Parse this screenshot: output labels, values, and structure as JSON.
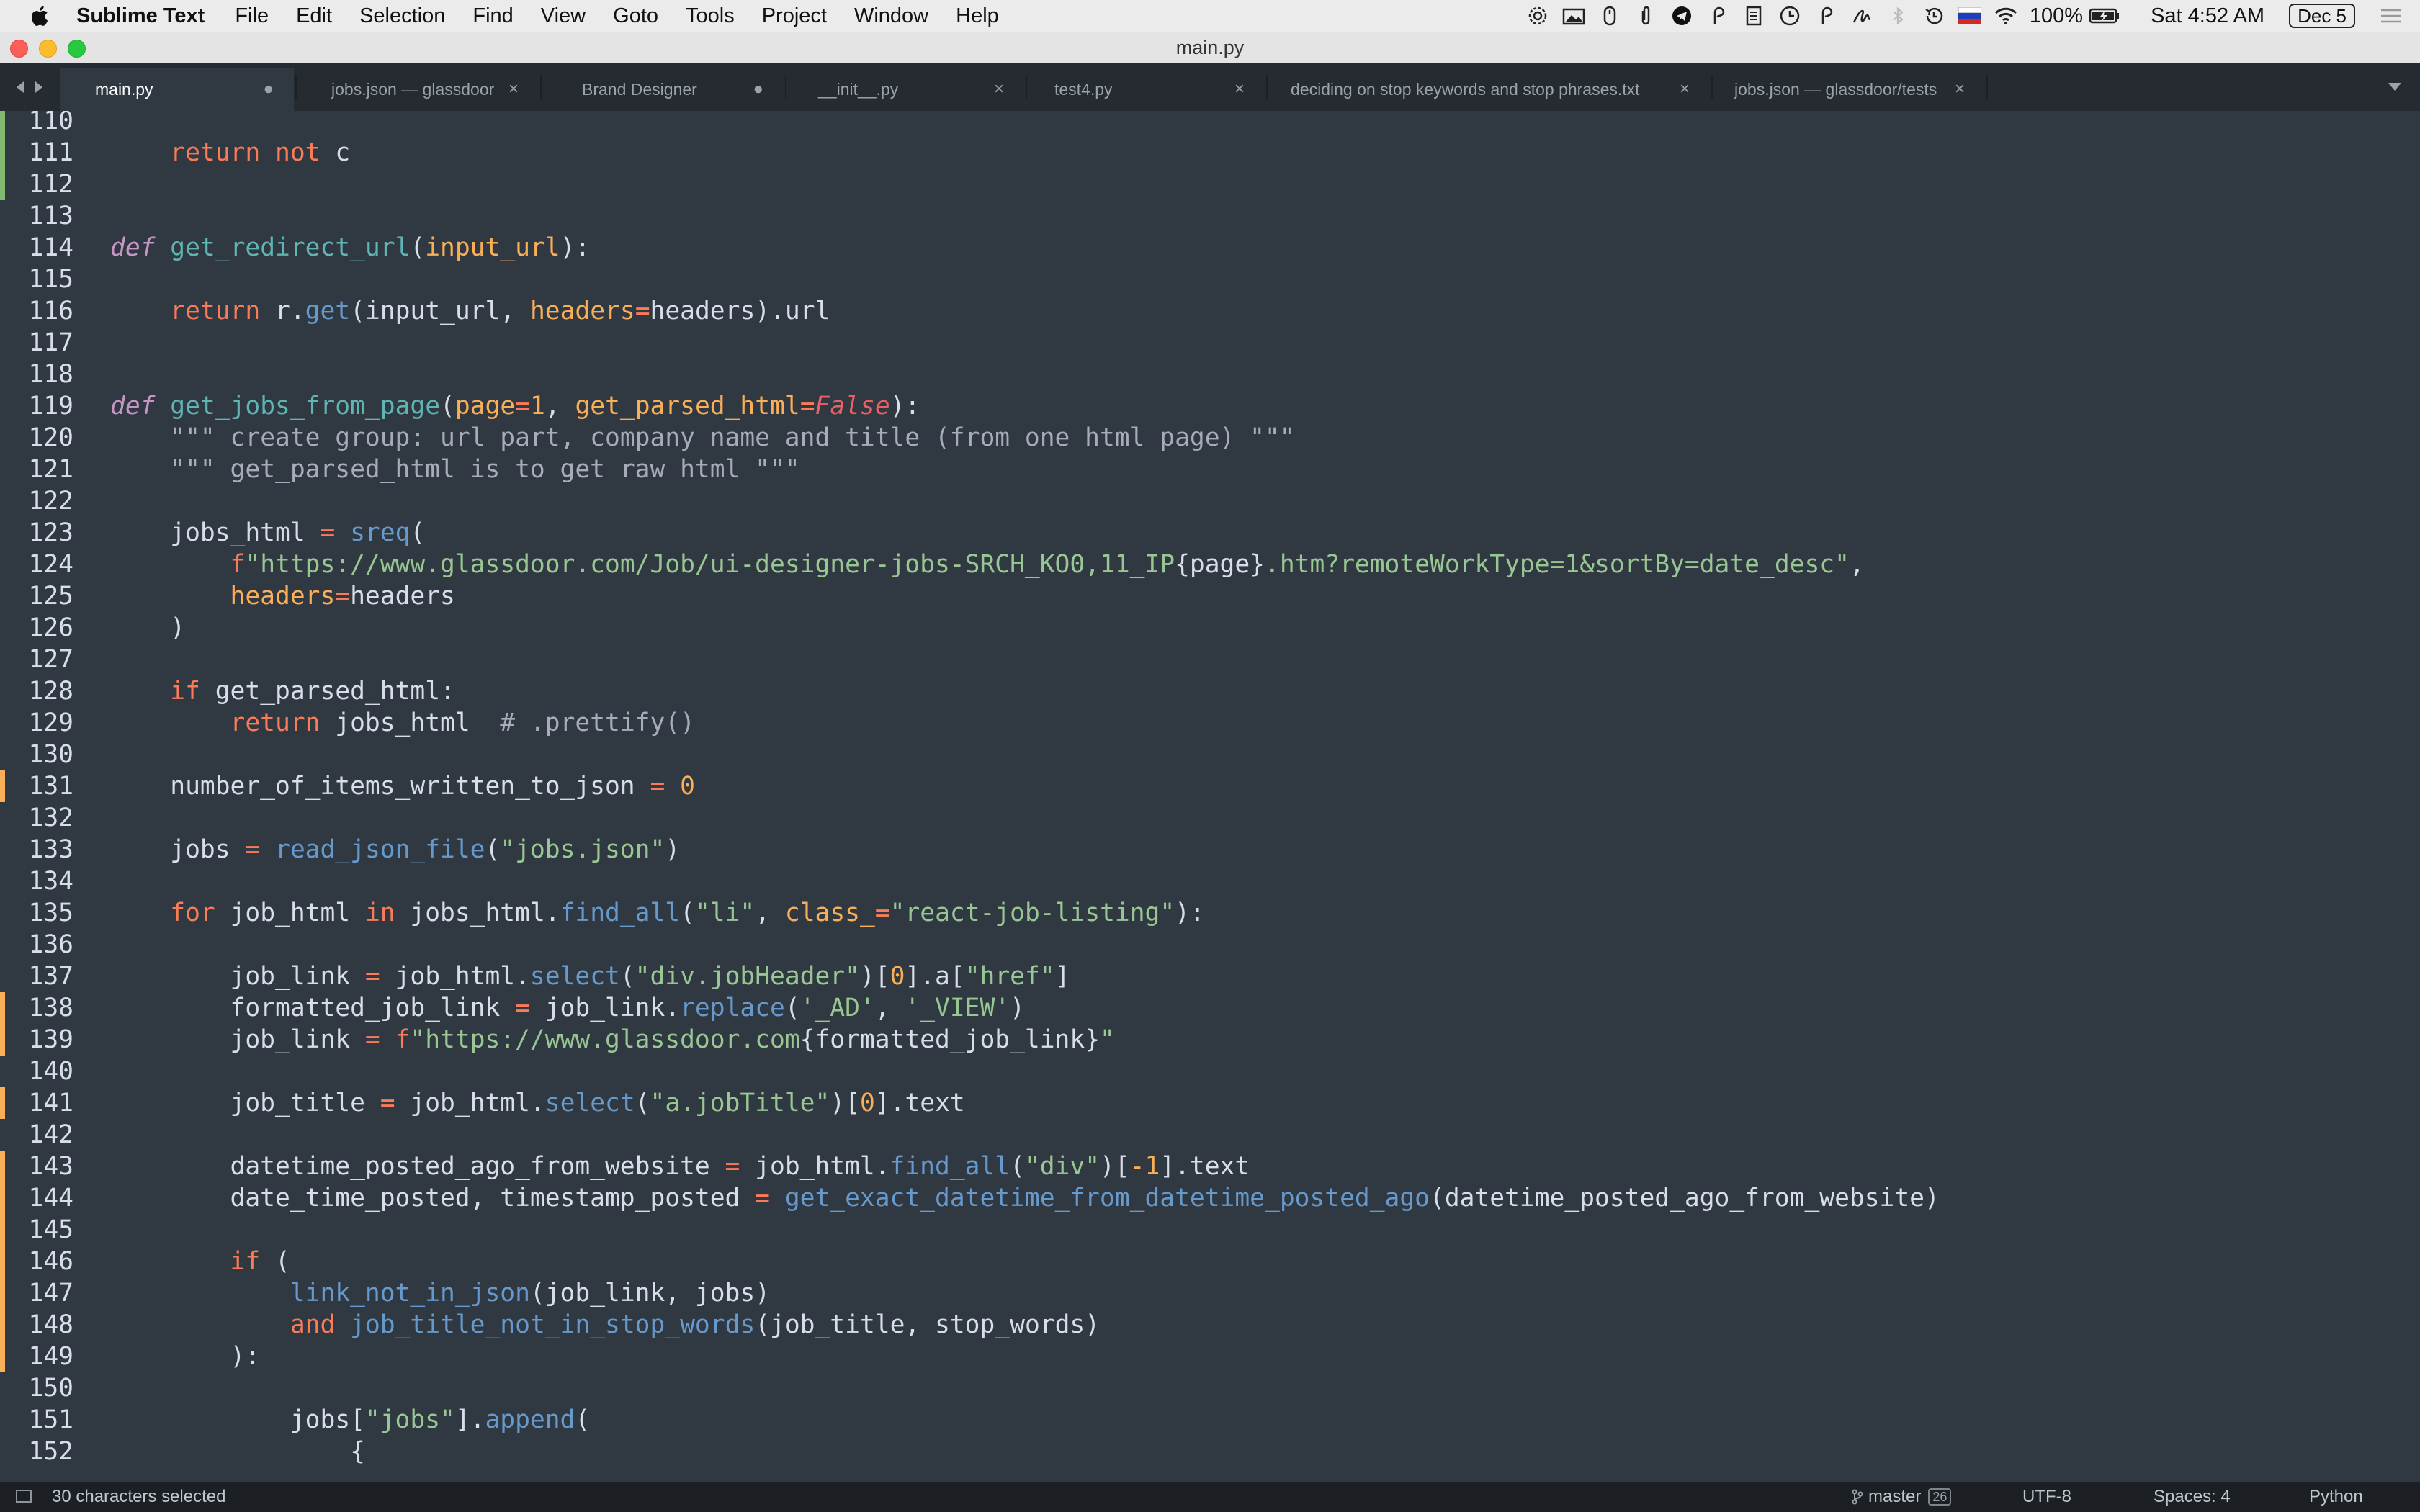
{
  "menubar": {
    "app_name": "Sublime Text",
    "items": [
      "File",
      "Edit",
      "Selection",
      "Find",
      "View",
      "Goto",
      "Tools",
      "Project",
      "Window",
      "Help"
    ],
    "battery": "100%",
    "clock": "Sat 4:52 AM",
    "date_badge": "Dec 5"
  },
  "window": {
    "title": "main.py"
  },
  "tabs": [
    {
      "label": "main.py",
      "state": "modified"
    },
    {
      "label": "jobs.json — glassdoor",
      "state": "close"
    },
    {
      "label": "Brand Designer",
      "state": "modified"
    },
    {
      "label": "__init__.py",
      "state": "close"
    },
    {
      "label": "test4.py",
      "state": "close"
    },
    {
      "label": "deciding on stop keywords and stop phrases.txt",
      "state": "close"
    },
    {
      "label": "jobs.json — glassdoor/tests",
      "state": "close"
    }
  ],
  "tab_marks": {
    "modified": "●",
    "close": "×"
  },
  "editor": {
    "lines": [
      {
        "num": "110",
        "diff": "add",
        "tokens": []
      },
      {
        "num": "111",
        "diff": "add",
        "tokens": [
          [
            "plain",
            "    "
          ],
          [
            "kw",
            "return"
          ],
          [
            "plain",
            " "
          ],
          [
            "kw",
            "not"
          ],
          [
            "plain",
            " c"
          ]
        ]
      },
      {
        "num": "112",
        "diff": "add",
        "tokens": []
      },
      {
        "num": "113",
        "diff": "",
        "tokens": []
      },
      {
        "num": "114",
        "diff": "",
        "tokens": [
          [
            "def",
            "def"
          ],
          [
            "plain",
            " "
          ],
          [
            "fn",
            "get_redirect_url"
          ],
          [
            "plain",
            "("
          ],
          [
            "param",
            "input_url"
          ],
          [
            "plain",
            "):"
          ]
        ]
      },
      {
        "num": "115",
        "diff": "",
        "tokens": []
      },
      {
        "num": "116",
        "diff": "",
        "tokens": [
          [
            "plain",
            "    "
          ],
          [
            "kw",
            "return"
          ],
          [
            "plain",
            " r."
          ],
          [
            "call",
            "get"
          ],
          [
            "plain",
            "(input_url, "
          ],
          [
            "param",
            "headers"
          ],
          [
            "kw",
            "="
          ],
          [
            "plain",
            "headers).url"
          ]
        ]
      },
      {
        "num": "117",
        "diff": "",
        "tokens": []
      },
      {
        "num": "118",
        "diff": "",
        "tokens": []
      },
      {
        "num": "119",
        "diff": "",
        "tokens": [
          [
            "def",
            "def"
          ],
          [
            "plain",
            " "
          ],
          [
            "fn",
            "get_jobs_from_page"
          ],
          [
            "plain",
            "("
          ],
          [
            "param",
            "page"
          ],
          [
            "kw",
            "="
          ],
          [
            "num",
            "1"
          ],
          [
            "plain",
            ", "
          ],
          [
            "param",
            "get_parsed_html"
          ],
          [
            "kw",
            "="
          ],
          [
            "bool",
            "False"
          ],
          [
            "plain",
            "):"
          ]
        ]
      },
      {
        "num": "120",
        "diff": "",
        "tokens": [
          [
            "plain",
            "    "
          ],
          [
            "comment",
            "\"\"\" create group: url part, company name and title (from one html page) \"\"\""
          ]
        ]
      },
      {
        "num": "121",
        "diff": "",
        "tokens": [
          [
            "plain",
            "    "
          ],
          [
            "comment",
            "\"\"\" get_parsed_html is to get raw html \"\"\""
          ]
        ]
      },
      {
        "num": "122",
        "diff": "",
        "tokens": []
      },
      {
        "num": "123",
        "diff": "",
        "tokens": [
          [
            "plain",
            "    jobs_html "
          ],
          [
            "kw",
            "="
          ],
          [
            "plain",
            " "
          ],
          [
            "call",
            "sreq"
          ],
          [
            "plain",
            "("
          ]
        ]
      },
      {
        "num": "124",
        "diff": "",
        "tokens": [
          [
            "plain",
            "        "
          ],
          [
            "kw",
            "f"
          ],
          [
            "str",
            "\"https://www.glassdoor.com/Job/ui-designer-jobs-SRCH_KO0,11_IP"
          ],
          [
            "plain",
            "{page}"
          ],
          [
            "str",
            ".htm?remoteWorkType=1&sortBy=date_desc\""
          ],
          [
            "plain",
            ","
          ]
        ]
      },
      {
        "num": "125",
        "diff": "",
        "tokens": [
          [
            "plain",
            "        "
          ],
          [
            "param",
            "headers"
          ],
          [
            "kw",
            "="
          ],
          [
            "plain",
            "headers"
          ]
        ]
      },
      {
        "num": "126",
        "diff": "",
        "tokens": [
          [
            "plain",
            "    )"
          ]
        ]
      },
      {
        "num": "127",
        "diff": "",
        "tokens": []
      },
      {
        "num": "128",
        "diff": "",
        "tokens": [
          [
            "plain",
            "    "
          ],
          [
            "kw",
            "if"
          ],
          [
            "plain",
            " get_parsed_html:"
          ]
        ]
      },
      {
        "num": "129",
        "diff": "",
        "tokens": [
          [
            "plain",
            "        "
          ],
          [
            "kw",
            "return"
          ],
          [
            "plain",
            " jobs_html  "
          ],
          [
            "comment",
            "# .prettify()"
          ]
        ]
      },
      {
        "num": "130",
        "diff": "",
        "tokens": []
      },
      {
        "num": "131",
        "diff": "mod",
        "tokens": [
          [
            "plain",
            "    number_of_items_written_to_json "
          ],
          [
            "kw",
            "="
          ],
          [
            "plain",
            " "
          ],
          [
            "num",
            "0"
          ]
        ]
      },
      {
        "num": "132",
        "diff": "",
        "tokens": []
      },
      {
        "num": "133",
        "diff": "",
        "tokens": [
          [
            "plain",
            "    jobs "
          ],
          [
            "kw",
            "="
          ],
          [
            "plain",
            " "
          ],
          [
            "call",
            "read_json_file"
          ],
          [
            "plain",
            "("
          ],
          [
            "str",
            "\"jobs.json\""
          ],
          [
            "plain",
            ")"
          ]
        ]
      },
      {
        "num": "134",
        "diff": "",
        "tokens": []
      },
      {
        "num": "135",
        "diff": "",
        "tokens": [
          [
            "plain",
            "    "
          ],
          [
            "kw",
            "for"
          ],
          [
            "plain",
            " job_html "
          ],
          [
            "kw",
            "in"
          ],
          [
            "plain",
            " jobs_html."
          ],
          [
            "call",
            "find_all"
          ],
          [
            "plain",
            "("
          ],
          [
            "str",
            "\"li\""
          ],
          [
            "plain",
            ", "
          ],
          [
            "param",
            "class_"
          ],
          [
            "kw",
            "="
          ],
          [
            "str",
            "\"react-job-listing\""
          ],
          [
            "plain",
            "):"
          ]
        ]
      },
      {
        "num": "136",
        "diff": "",
        "tokens": []
      },
      {
        "num": "137",
        "diff": "",
        "tokens": [
          [
            "plain",
            "        job_link "
          ],
          [
            "kw",
            "="
          ],
          [
            "plain",
            " job_html."
          ],
          [
            "call",
            "select"
          ],
          [
            "plain",
            "("
          ],
          [
            "str",
            "\"div.jobHeader\""
          ],
          [
            "plain",
            ")["
          ],
          [
            "num",
            "0"
          ],
          [
            "plain",
            "].a["
          ],
          [
            "str",
            "\"href\""
          ],
          [
            "plain",
            "]"
          ]
        ]
      },
      {
        "num": "138",
        "diff": "mod",
        "tokens": [
          [
            "plain",
            "        formatted_job_link "
          ],
          [
            "kw",
            "="
          ],
          [
            "plain",
            " job_link."
          ],
          [
            "call",
            "replace"
          ],
          [
            "plain",
            "("
          ],
          [
            "str",
            "'_AD'"
          ],
          [
            "plain",
            ", "
          ],
          [
            "str",
            "'_VIEW'"
          ],
          [
            "plain",
            ")"
          ]
        ]
      },
      {
        "num": "139",
        "diff": "mod",
        "tokens": [
          [
            "plain",
            "        job_link "
          ],
          [
            "kw",
            "="
          ],
          [
            "plain",
            " "
          ],
          [
            "kw",
            "f"
          ],
          [
            "str",
            "\"https://www.glassdoor.com"
          ],
          [
            "plain",
            "{formatted_job_link}"
          ],
          [
            "str",
            "\""
          ]
        ]
      },
      {
        "num": "140",
        "diff": "",
        "tokens": []
      },
      {
        "num": "141",
        "diff": "mod",
        "tokens": [
          [
            "plain",
            "        job_title "
          ],
          [
            "kw",
            "="
          ],
          [
            "plain",
            " job_html."
          ],
          [
            "call",
            "select"
          ],
          [
            "plain",
            "("
          ],
          [
            "str",
            "\"a.jobTitle\""
          ],
          [
            "plain",
            ")["
          ],
          [
            "num",
            "0"
          ],
          [
            "plain",
            "].text"
          ]
        ]
      },
      {
        "num": "142",
        "diff": "",
        "tokens": []
      },
      {
        "num": "143",
        "diff": "mod",
        "tokens": [
          [
            "plain",
            "        datetime_posted_ago_from_website "
          ],
          [
            "kw",
            "="
          ],
          [
            "plain",
            " job_html."
          ],
          [
            "call",
            "find_all"
          ],
          [
            "plain",
            "("
          ],
          [
            "str",
            "\"div\""
          ],
          [
            "plain",
            ")["
          ],
          [
            "num",
            "-1"
          ],
          [
            "plain",
            "].text"
          ]
        ]
      },
      {
        "num": "144",
        "diff": "mod",
        "tokens": [
          [
            "plain",
            "        date_time_posted, timestamp_posted "
          ],
          [
            "kw",
            "="
          ],
          [
            "plain",
            " "
          ],
          [
            "call",
            "get_exact_datetime_from_datetime_posted_ago"
          ],
          [
            "plain",
            "(datetime_posted_ago_from_website)"
          ]
        ]
      },
      {
        "num": "145",
        "diff": "mod",
        "tokens": []
      },
      {
        "num": "146",
        "diff": "mod",
        "tokens": [
          [
            "plain",
            "        "
          ],
          [
            "kw",
            "if"
          ],
          [
            "plain",
            " ("
          ]
        ]
      },
      {
        "num": "147",
        "diff": "mod",
        "tokens": [
          [
            "plain",
            "            "
          ],
          [
            "call",
            "link_not_in_json"
          ],
          [
            "plain",
            "(job_link, jobs)"
          ]
        ]
      },
      {
        "num": "148",
        "diff": "mod",
        "tokens": [
          [
            "plain",
            "            "
          ],
          [
            "kw",
            "and"
          ],
          [
            "plain",
            " "
          ],
          [
            "call",
            "job_title_not_in_stop_words"
          ],
          [
            "plain",
            "(job_title, stop_words)"
          ]
        ]
      },
      {
        "num": "149",
        "diff": "mod",
        "tokens": [
          [
            "plain",
            "        ):"
          ]
        ]
      },
      {
        "num": "150",
        "diff": "",
        "tokens": []
      },
      {
        "num": "151",
        "diff": "",
        "tokens": [
          [
            "plain",
            "            jobs["
          ],
          [
            "str",
            "\"jobs\""
          ],
          [
            "plain",
            "]."
          ],
          [
            "call",
            "append"
          ],
          [
            "plain",
            "("
          ]
        ]
      },
      {
        "num": "152",
        "diff": "",
        "tokens": [
          [
            "plain",
            "                {"
          ]
        ]
      }
    ]
  },
  "statusbar": {
    "selection": "30 characters selected",
    "branch": "master",
    "branch_count": "26",
    "encoding": "UTF-8",
    "indentation": "Spaces: 4",
    "syntax": "Python"
  },
  "colors": {
    "editor_bg": "#303841",
    "keyword": "#f97b58",
    "function_def": "#5fb4b4",
    "function_call": "#6699cc",
    "parameter": "#f9ae58",
    "string": "#99c794",
    "comment": "#a6acb9",
    "diff_modified": "#f9ae58",
    "diff_added": "#81b96e"
  }
}
